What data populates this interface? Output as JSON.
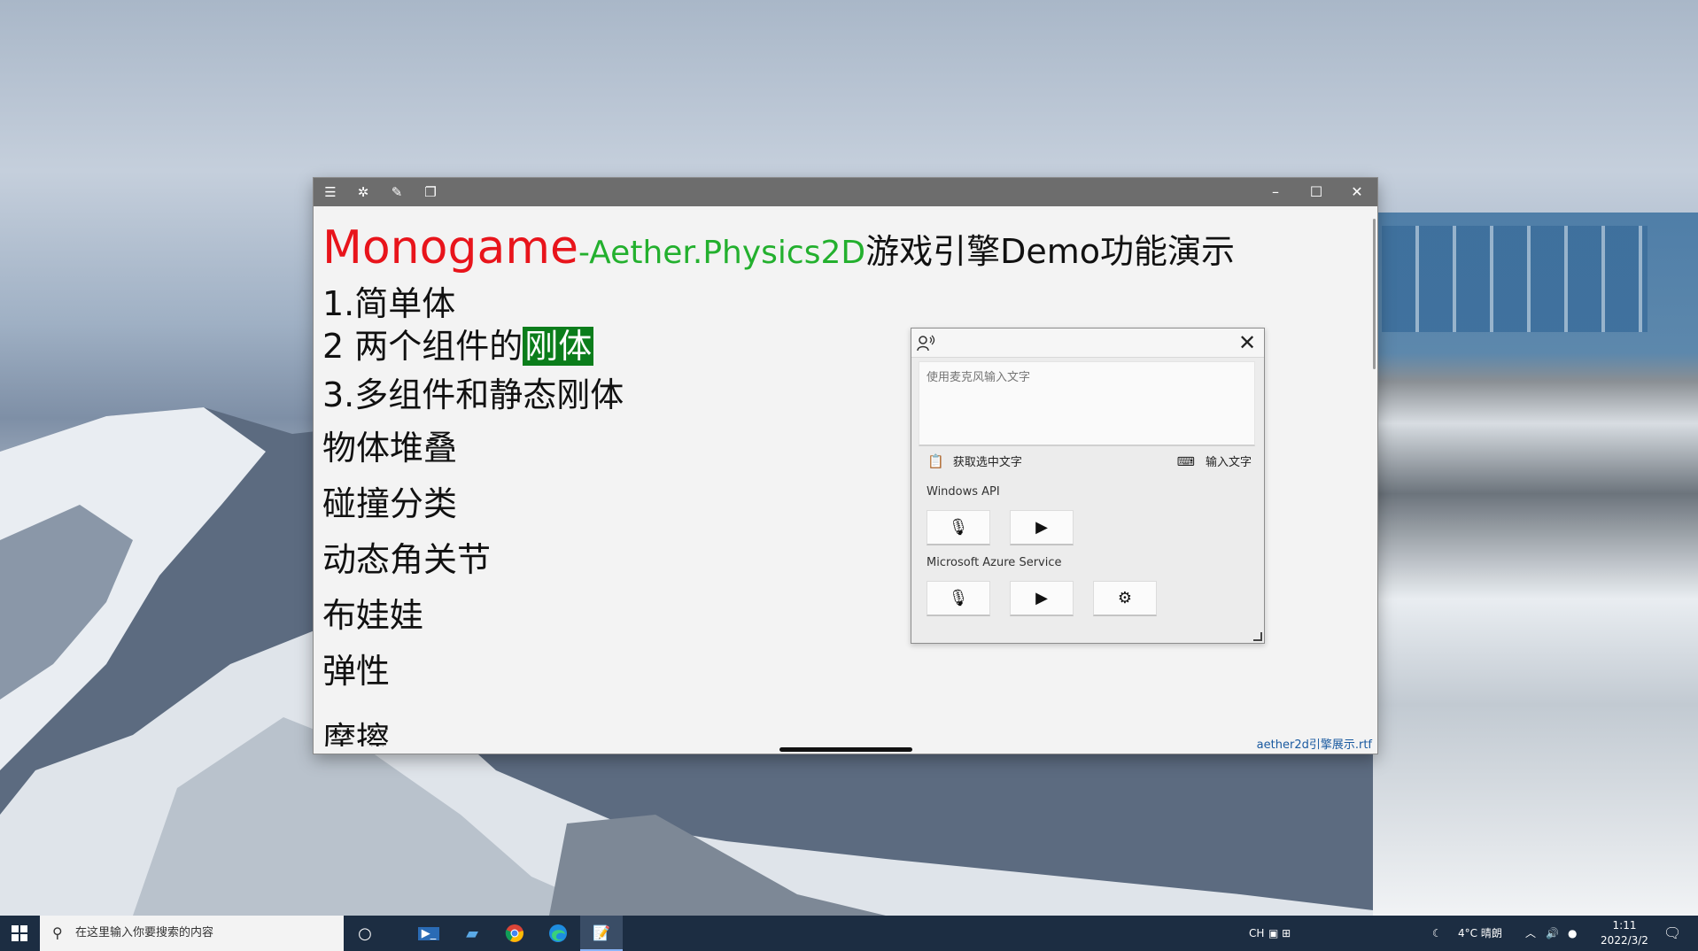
{
  "window": {
    "toolbar_icons": [
      "menu-icon",
      "settings-icon",
      "edit-icon",
      "copy-icon"
    ],
    "controls": {
      "minimize": "–",
      "maximize": "☐",
      "close": "✕"
    },
    "filename": "aether2d引擎展示.rtf"
  },
  "document": {
    "title_part1": "Monogame",
    "title_part2": "-Aether.Physics2D",
    "title_part3": "游戏引擎Demo功能演示",
    "items": [
      {
        "pre": "1.简单体",
        "hl": ""
      },
      {
        "pre": "2 两个组件的",
        "hl": "刚体"
      },
      {
        "pre": "3.多组件和静态刚体",
        "hl": ""
      },
      {
        "pre": "物体堆叠",
        "hl": ""
      },
      {
        "pre": "碰撞分类",
        "hl": ""
      },
      {
        "pre": "动态角关节",
        "hl": ""
      },
      {
        "pre": "布娃娃",
        "hl": ""
      },
      {
        "pre": "弹性",
        "hl": ""
      },
      {
        "pre": "摩擦",
        "hl": ""
      }
    ],
    "highlight_color": "#0b7d1b",
    "title_colors": {
      "red": "#e8141b",
      "green": "#23b02e"
    }
  },
  "voice_panel": {
    "placeholder": "使用麦克风输入文字",
    "get_selected": "获取选中文字",
    "input_text": "输入文字",
    "windows_api": "Windows API",
    "azure": "Microsoft Azure Service"
  },
  "taskbar": {
    "search_placeholder": "在这里输入你要搜索的内容",
    "ime": "CH",
    "weather": "4°C 晴朗",
    "time": "1:11",
    "date": "2022/3/2"
  }
}
